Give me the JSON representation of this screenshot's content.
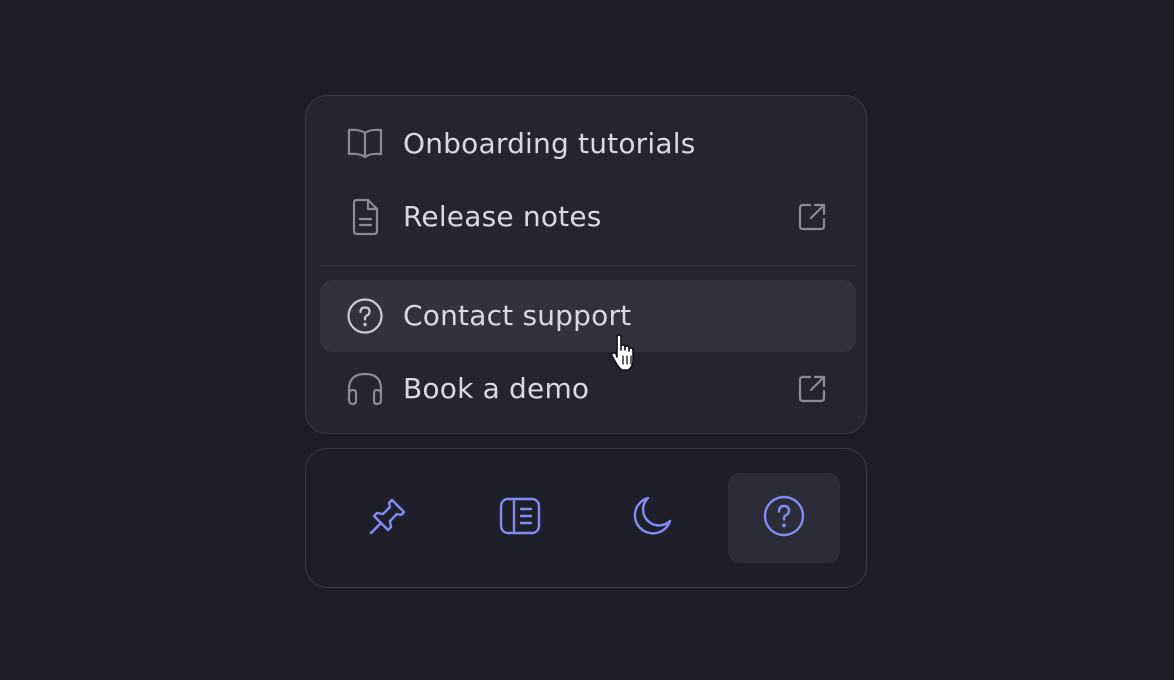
{
  "help_menu": {
    "items": [
      {
        "label": "Onboarding tutorials",
        "icon": "book-open-icon",
        "external": false,
        "hovered": false
      },
      {
        "label": "Release notes",
        "icon": "document-icon",
        "external": true,
        "external_icon": "external-link-icon",
        "hovered": false
      },
      {
        "label": "Contact support",
        "icon": "help-circle-icon",
        "external": false,
        "hovered": true
      },
      {
        "label": "Book a demo",
        "icon": "headphones-icon",
        "external": true,
        "external_icon": "external-link-icon",
        "hovered": false
      }
    ]
  },
  "toolbar": {
    "buttons": [
      {
        "icon": "pin-icon",
        "active": false
      },
      {
        "icon": "sidebar-panel-icon",
        "active": false
      },
      {
        "icon": "moon-icon",
        "active": false
      },
      {
        "icon": "help-circle-icon",
        "active": true
      }
    ]
  },
  "cursor": {
    "icon": "hand-pointer-icon"
  },
  "colors": {
    "background": "#1e1e29",
    "panel": "#252532",
    "panel_border": "#3a3a48",
    "hover": "#32323f",
    "text": "#d9d9e3",
    "muted_icon": "#8a8a98",
    "accent": "#7f8cf2"
  }
}
